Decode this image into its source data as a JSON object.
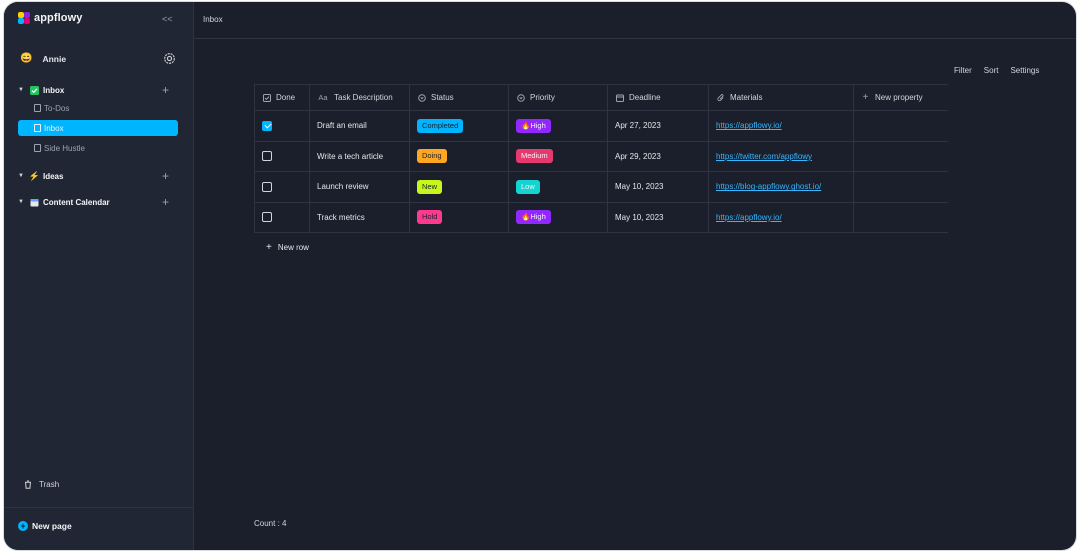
{
  "app": {
    "name": "appflowy"
  },
  "sidebar": {
    "user": {
      "name": "Annie",
      "avatar": "😄"
    },
    "workspaces": [
      {
        "label": "Inbox",
        "icon": "checkbox-icon",
        "expanded": true,
        "children": [
          "To-Dos",
          "Inbox",
          "Side Hustle"
        ]
      },
      {
        "label": "Ideas",
        "icon": "lightning-icon",
        "expanded": false
      },
      {
        "label": "Content Calendar",
        "icon": "calendar-icon",
        "expanded": false
      }
    ],
    "active_child": "Inbox",
    "trash_label": "Trash",
    "new_page_label": "New page"
  },
  "header": {
    "breadcrumb": "Inbox"
  },
  "toolbar": {
    "filter": "Filter",
    "sort": "Sort",
    "settings": "Settings"
  },
  "grid": {
    "columns": [
      {
        "label": "Done",
        "icon": "checkbox-icon"
      },
      {
        "label": "Task Description",
        "icon": "text-icon"
      },
      {
        "label": "Status",
        "icon": "select-icon"
      },
      {
        "label": "Priority",
        "icon": "select-icon"
      },
      {
        "label": "Deadline",
        "icon": "calendar-icon"
      },
      {
        "label": "Materials",
        "icon": "attachment-icon"
      },
      {
        "label": "New property",
        "icon": "plus-icon"
      }
    ],
    "rows": [
      {
        "done": true,
        "task": "Draft an email",
        "status": "Completed",
        "status_color": "#00b5ff",
        "priority": "🔥High",
        "priority_color": "#9327ff",
        "deadline": "Apr 27, 2023",
        "materials": "https://appflowy.io/"
      },
      {
        "done": false,
        "task": "Write a tech article",
        "status": "Doing",
        "status_color": "#ffa620",
        "priority": "Medium",
        "priority_color": "#e8396e",
        "deadline": "Apr 29, 2023",
        "materials": "https://twitter.com/appflowy"
      },
      {
        "done": false,
        "task": "Launch review",
        "status": "New",
        "status_color": "#c6f71a",
        "priority": "Low",
        "priority_color": "#13d4d1",
        "deadline": "May 10, 2023",
        "materials": "https://blog-appflowy.ghost.io/"
      },
      {
        "done": false,
        "task": "Track metrics",
        "status": "Hold",
        "status_color": "#ff3a8e",
        "priority": "🔥High",
        "priority_color": "#9327ff",
        "deadline": "May 10, 2023",
        "materials": "https://appflowy.io/"
      }
    ],
    "new_row_label": "New row",
    "count_label": "Count : 4"
  }
}
